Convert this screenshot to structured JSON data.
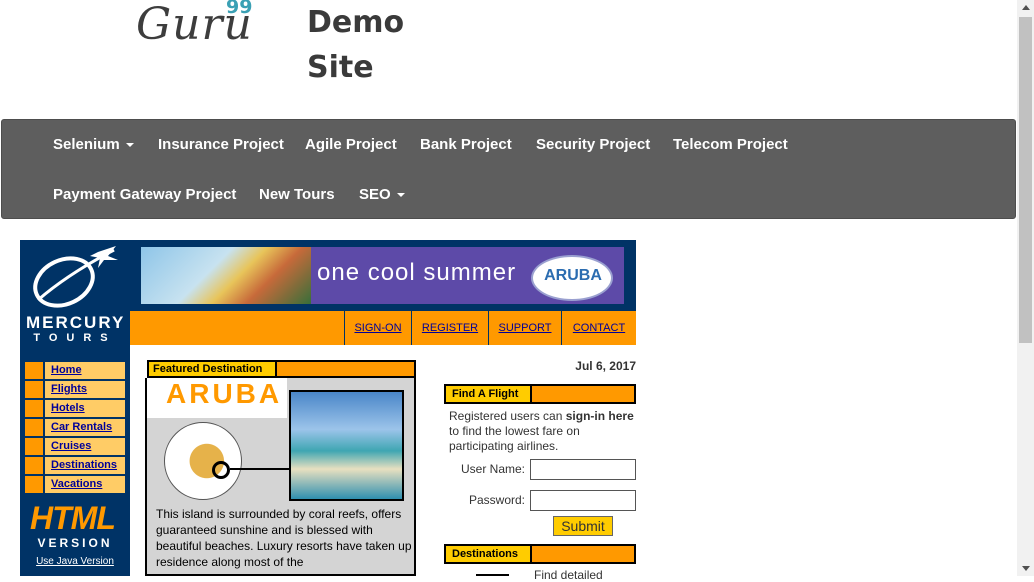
{
  "header": {
    "logo_text": "Guru",
    "logo_superscript": "99",
    "site_title_line1": "Demo",
    "site_title_line2": "Site"
  },
  "navbar": {
    "items": [
      {
        "label": "Selenium",
        "dropdown": true
      },
      {
        "label": "Insurance Project",
        "dropdown": false
      },
      {
        "label": "Agile Project",
        "dropdown": false
      },
      {
        "label": "Bank Project",
        "dropdown": false
      },
      {
        "label": "Security Project",
        "dropdown": false
      },
      {
        "label": "Telecom Project",
        "dropdown": false
      },
      {
        "label": "Payment Gateway Project",
        "dropdown": false
      },
      {
        "label": "New Tours",
        "dropdown": false
      },
      {
        "label": "SEO",
        "dropdown": true
      }
    ]
  },
  "mercury": {
    "brand_line1": "MERCURY",
    "brand_line2": "TOURS",
    "side_nav": [
      "Home",
      "Flights",
      "Hotels",
      "Car Rentals",
      "Cruises",
      "Destinations",
      "Vacations"
    ],
    "html_badge": "HTML",
    "version_label": "VERSION",
    "java_link": "Use Java Version",
    "banner_text": "one cool summer",
    "banner_logo": "ARUBA",
    "top_links": [
      "SIGN-ON",
      "REGISTER",
      "SUPPORT",
      "CONTACT"
    ],
    "featured_label": "Featured Destination",
    "featured_name": "ARUBA",
    "featured_text": "This island is surrounded by coral reefs, offers guaranteed sunshine and is blessed with beautiful beaches. Luxury resorts have taken up residence along most of the",
    "date": "Jul 6, 2017",
    "find_flight_label": "Find A Flight",
    "info_part1": "Registered users can ",
    "info_bold": "sign-in here",
    "info_part2": " to find the lowest fare on participating airlines.",
    "username_label": "User Name:",
    "password_label": "Password:",
    "username_value": "",
    "password_value": "",
    "submit_label": "Submit",
    "destinations_label": "Destinations",
    "destinations_text": "Find detailed"
  },
  "colors": {
    "navbar_bg": "#5e5e5e",
    "mercury_blue": "#003366",
    "orange": "#ff9900",
    "gold": "#ffcc00",
    "link_blue": "#000099"
  }
}
